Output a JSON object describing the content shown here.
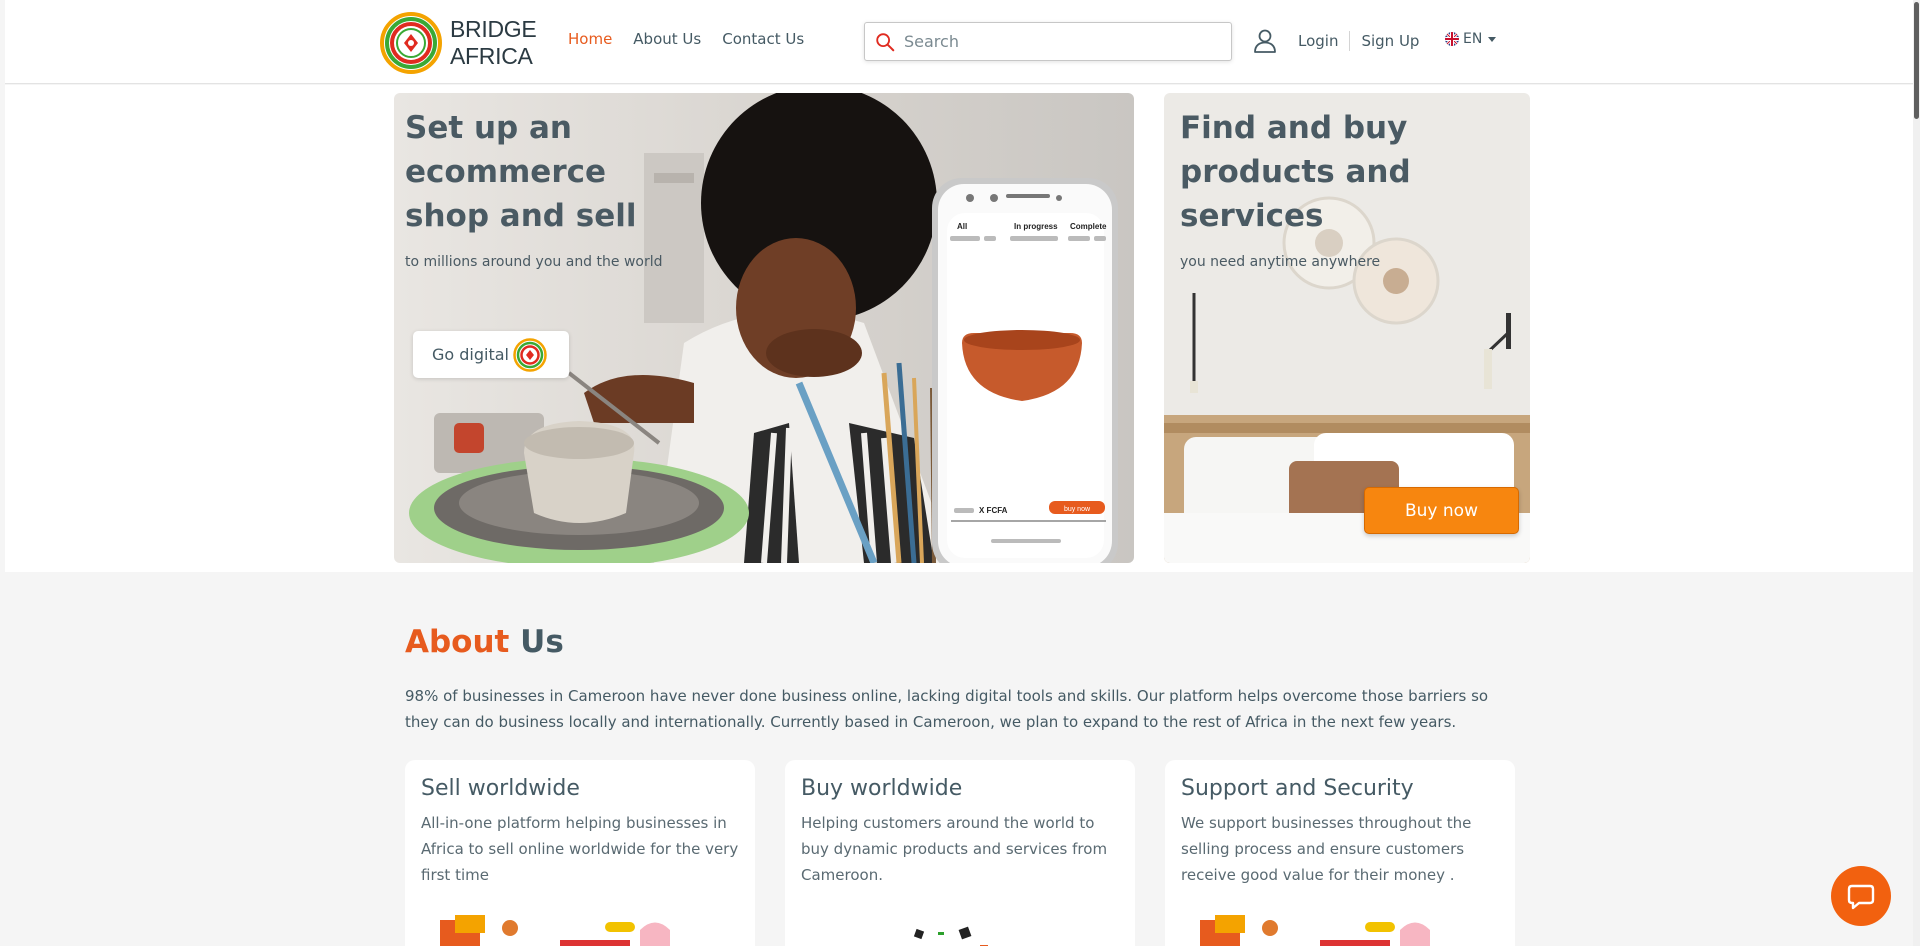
{
  "brand": {
    "line1": "BRIDGE",
    "line2": "AFRICA"
  },
  "nav": {
    "home": "Home",
    "about": "About Us",
    "contact": "Contact Us"
  },
  "search": {
    "placeholder": "Search"
  },
  "auth": {
    "login": "Login",
    "signup": "Sign Up"
  },
  "language": {
    "code": "EN"
  },
  "hero_left": {
    "title_lines": [
      "Set up an",
      "ecommerce",
      "shop and sell"
    ],
    "subtitle": "to millions around you and the world",
    "cta": "Go digital",
    "phone": {
      "tab_all": "All",
      "tab_progress": "In progress",
      "tab_complete": "Complete",
      "price": "X FCFA",
      "buy": "buy now"
    }
  },
  "hero_right": {
    "title_lines": [
      "Find and buy",
      "products and",
      "services"
    ],
    "subtitle": "you need anytime anywhere",
    "cta": "Buy now"
  },
  "about": {
    "title_accent": "About",
    "title_rest": "Us",
    "text": "98% of businesses in Cameroon have never done business online, lacking digital tools and skills. Our platform helps overcome those barriers so they can do business locally and internationally. Currently based in Cameroon, we plan to expand to the rest of Africa in the next few years."
  },
  "cards": [
    {
      "title": "Sell worldwide",
      "text": "All-in-one platform helping businesses in Africa to sell online worldwide for the very first time"
    },
    {
      "title": "Buy worldwide",
      "text": "Helping customers around the world to buy dynamic products and services from Cameroon."
    },
    {
      "title": "Support and Security",
      "text": "We support businesses throughout the selling process and ensure customers receive good value for their money ."
    }
  ],
  "colors": {
    "accent": "#e75b1e",
    "text": "#455a64",
    "buy_button": "#f7860f",
    "chat": "#f2610f"
  },
  "icons": [
    "search-icon",
    "user-icon",
    "flag-icon",
    "chevron-down-icon",
    "chat-icon"
  ]
}
